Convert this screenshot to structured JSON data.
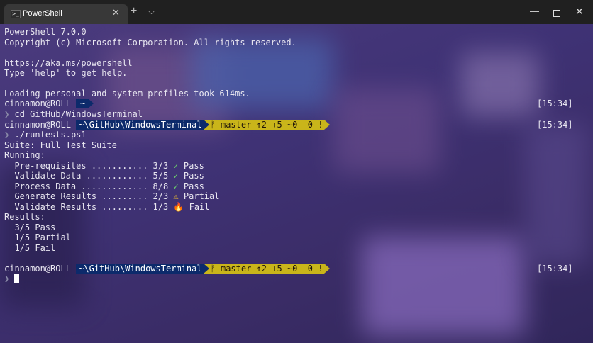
{
  "window": {
    "tab_title": "PowerShell",
    "tab_icon": "powershell-icon",
    "close_glyph": "✕",
    "newtab_glyph": "+",
    "dropdown_glyph": "⌵",
    "min_glyph": "—",
    "close_win_glyph": "✕"
  },
  "terminal": {
    "header_lines": [
      "PowerShell 7.0.0",
      "Copyright (c) Microsoft Corporation. All rights reserved.",
      "https://aka.ms/powershell",
      "Type 'help' to get help.",
      "Loading personal and system profiles took 614ms."
    ],
    "prompts": [
      {
        "user": "cinnamon@ROLL",
        "path": "~",
        "git": "",
        "time": "[15:34]",
        "command": "cd GitHub/WindowsTerminal"
      },
      {
        "user": "cinnamon@ROLL",
        "path": "~\\GitHub\\WindowsTerminal",
        "git": "ᚠ master ↑2 +5 ~0 -0 !",
        "time": "[15:34]",
        "command": "./runtests.ps1"
      },
      {
        "user": "cinnamon@ROLL",
        "path": "~\\GitHub\\WindowsTerminal",
        "git": "ᚠ master ↑2 +5 ~0 -0 !",
        "time": "[15:34]",
        "command": ""
      }
    ],
    "prompt_char": "❯",
    "suite_line": "Suite: Full Test Suite",
    "running_label": "Running:",
    "tests": [
      {
        "text": "  Pre-requisites ........... 3/3",
        "icon": "✓",
        "status": "Pass",
        "kind": "pass"
      },
      {
        "text": "  Validate Data ............ 5/5",
        "icon": "✓",
        "status": "Pass",
        "kind": "pass"
      },
      {
        "text": "  Process Data ............. 8/8",
        "icon": "✓",
        "status": "Pass",
        "kind": "pass"
      },
      {
        "text": "  Generate Results ......... 2/3",
        "icon": "⚠",
        "status": "Partial",
        "kind": "warn"
      },
      {
        "text": "  Validate Results ......... 1/3",
        "icon": "🔥",
        "status": "Fail",
        "kind": "fire"
      }
    ],
    "results_label": "Results:",
    "results": [
      "  3/5 Pass",
      "  1/5 Partial",
      "  1/5 Fail"
    ]
  },
  "colors": {
    "path_bg": "#0c2a6b",
    "git_bg": "#c9b51a",
    "pass": "#6ccf6c",
    "warn": "#f2c12e",
    "fail": "#ff7a1a"
  }
}
